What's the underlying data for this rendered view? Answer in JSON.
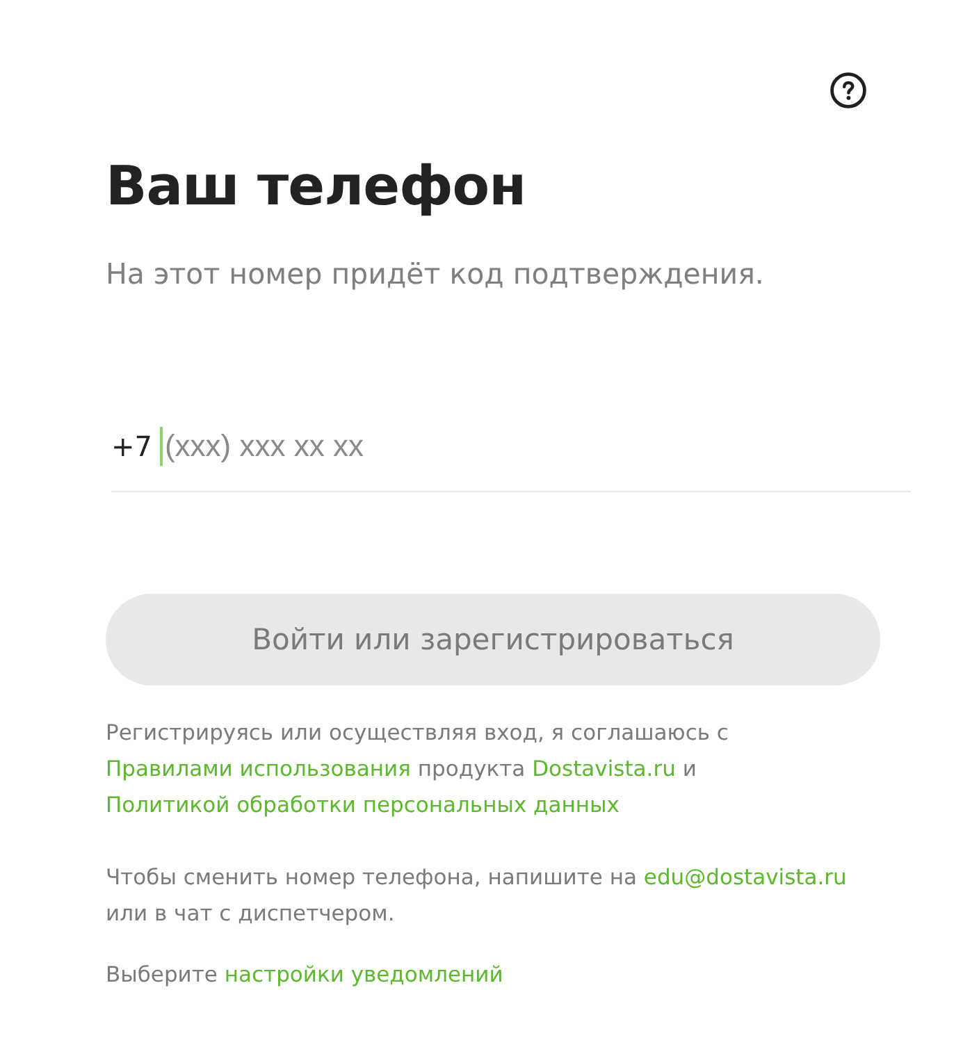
{
  "help": {
    "visible": true
  },
  "title": "Ваш телефон",
  "subtitle": "На этот номер придёт код подтверждения.",
  "phone": {
    "prefix": "+7",
    "placeholder": "(xxx) xxx xx xx",
    "focused": true
  },
  "submit_button": {
    "label": "Войти или зарегистрироваться",
    "disabled": true
  },
  "notices": [
    [
      {
        "kind": "text",
        "text": "Регистрируясь или осуществляя вход, я соглашаюсь с"
      },
      {
        "kind": "link",
        "text": "Правилами использования"
      },
      {
        "kind": "text",
        "text": "продукта"
      },
      {
        "kind": "link",
        "text": "Dostavista.ru"
      },
      {
        "kind": "text",
        "text": "и"
      },
      {
        "kind": "link",
        "text": "Политикой обработки персональных данных"
      }
    ],
    [
      {
        "kind": "text",
        "text": "Чтобы сменить номер телефона, напишите на"
      },
      {
        "kind": "link",
        "text": "edu@dostavista.ru"
      },
      {
        "kind": "text",
        "text": "или в чат с диспетчером."
      }
    ],
    [
      {
        "kind": "text",
        "text": "Выберите"
      },
      {
        "kind": "link",
        "text": "настройки уведомлений"
      }
    ]
  ]
}
